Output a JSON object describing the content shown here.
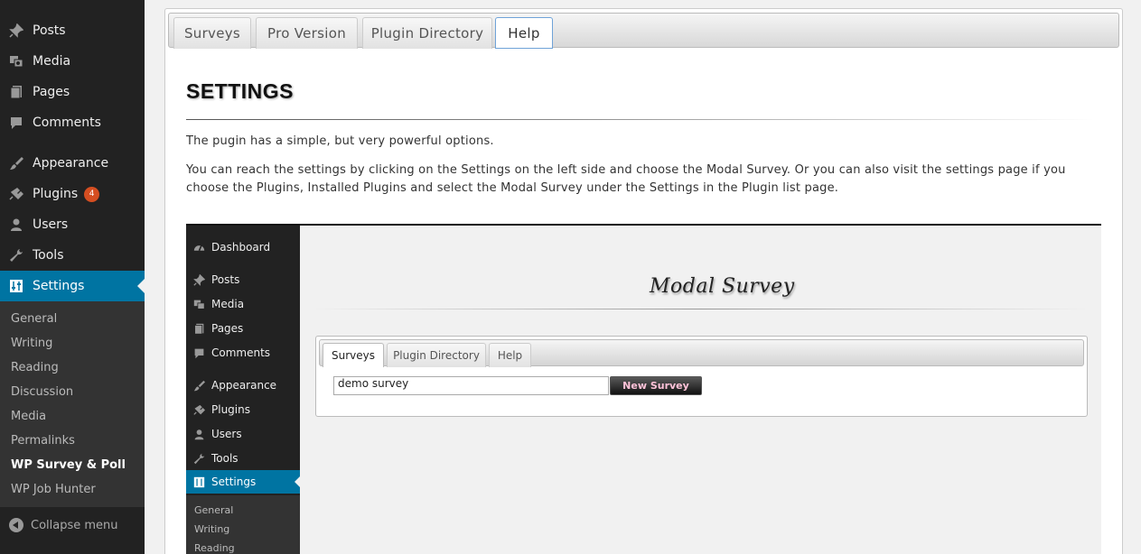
{
  "sidebar": {
    "items": [
      {
        "label": "Posts",
        "icon": "pin-icon"
      },
      {
        "label": "Media",
        "icon": "media-icon"
      },
      {
        "label": "Pages",
        "icon": "pages-icon"
      },
      {
        "label": "Comments",
        "icon": "comment-icon"
      },
      {
        "label": "Appearance",
        "icon": "brush-icon"
      },
      {
        "label": "Plugins",
        "icon": "plugin-icon",
        "badge": "4"
      },
      {
        "label": "Users",
        "icon": "user-icon"
      },
      {
        "label": "Tools",
        "icon": "wrench-icon"
      },
      {
        "label": "Settings",
        "icon": "settings-icon",
        "current": true
      }
    ],
    "submenu": [
      "General",
      "Writing",
      "Reading",
      "Discussion",
      "Media",
      "Permalinks",
      "WP Survey & Poll",
      "WP Job Hunter"
    ],
    "submenu_active": "WP Survey & Poll",
    "collapse_label": "Collapse menu"
  },
  "tabs": [
    {
      "label": "Surveys"
    },
    {
      "label": "Pro Version"
    },
    {
      "label": "Plugin Directory"
    },
    {
      "label": "Help",
      "active": true
    }
  ],
  "main": {
    "title": "SETTINGS",
    "paragraph1": "The pugin has a simple, but very powerful options.",
    "paragraph2": "You can reach the settings by clicking on the Settings on the left side and choose the Modal Survey. Or you can also visit the settings page if you choose the Plugins, Installed Plugins and select the Modal Survey under the Settings in the Plugin list page."
  },
  "screenshot": {
    "sidebar": {
      "items": [
        "Dashboard",
        "Posts",
        "Media",
        "Pages",
        "Comments",
        "Appearance",
        "Plugins",
        "Users",
        "Tools",
        "Settings"
      ],
      "submenu": [
        "General",
        "Writing",
        "Reading"
      ]
    },
    "logo_text": "Modal Survey",
    "tabs": [
      "Surveys",
      "Plugin Directory",
      "Help"
    ],
    "input_value": "demo survey",
    "button_label": "New Survey"
  },
  "colors": {
    "sidebar_bg": "#222222",
    "submenu_bg": "#333333",
    "accent": "#0074a2",
    "badge": "#d54e21"
  }
}
